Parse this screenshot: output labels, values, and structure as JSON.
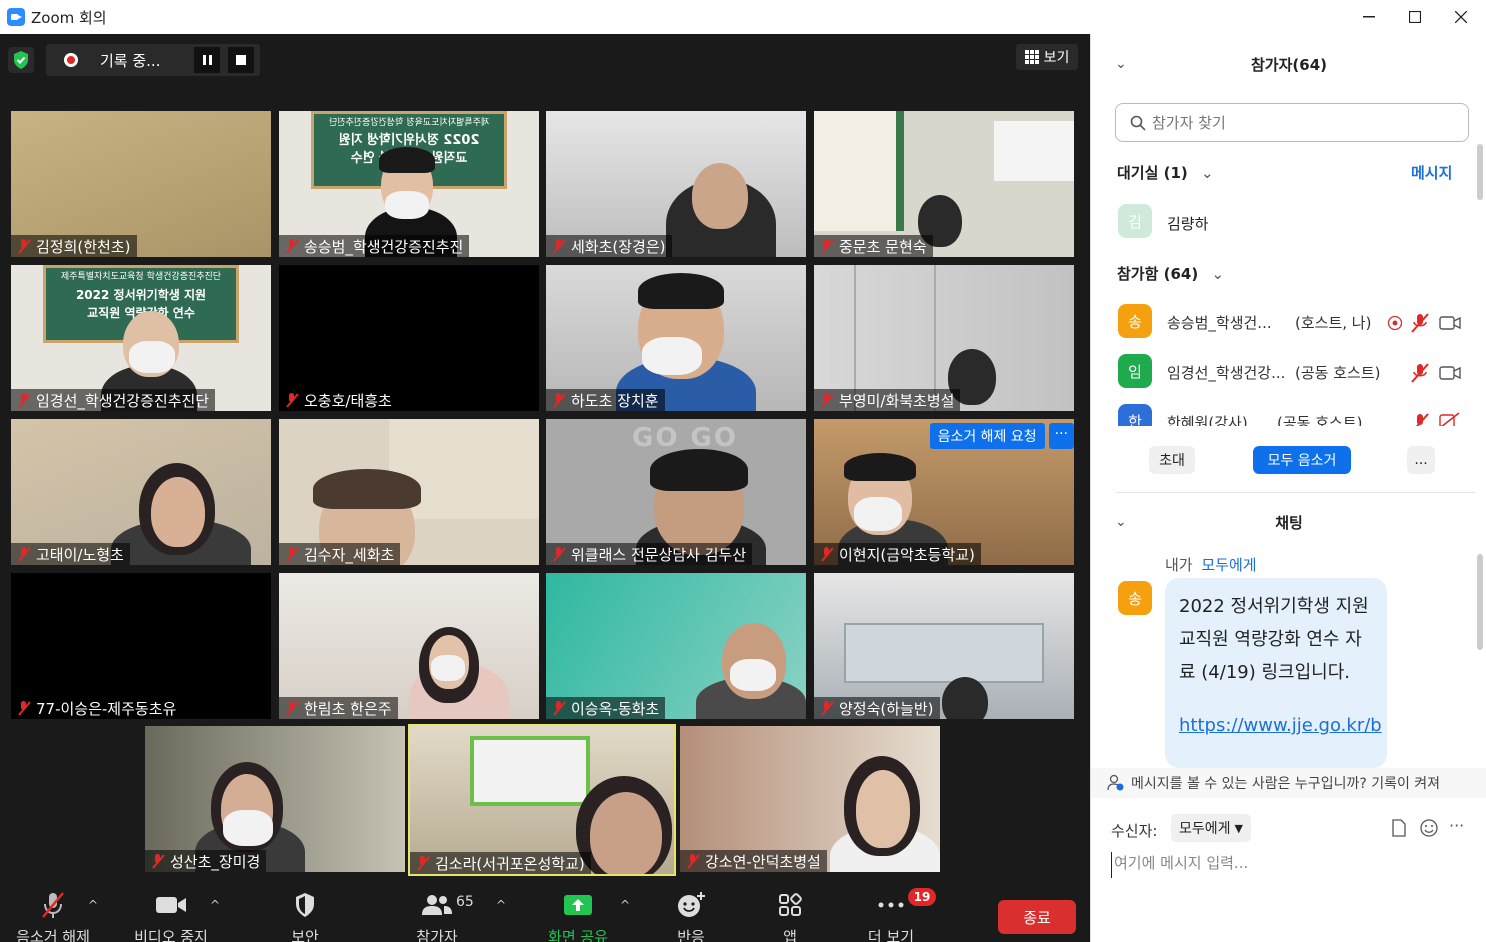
{
  "window": {
    "title": "Zoom 회의"
  },
  "recording": {
    "label": "기록 중..."
  },
  "view_button": {
    "label": "보기"
  },
  "tiles": [
    {
      "name": "김정희(한천초)"
    },
    {
      "name": "송승범_학생건강증진추진"
    },
    {
      "name": "세화초(장경은)"
    },
    {
      "name": "중문초 문현숙"
    },
    {
      "name": "임경선_학생건강증진추진단"
    },
    {
      "name": "오충호/태흥초"
    },
    {
      "name": "하도초 장치훈"
    },
    {
      "name": "부영미/화북초병설"
    },
    {
      "name": "고태이/노형초"
    },
    {
      "name": "김수자_세화초"
    },
    {
      "name": "위클래스 전문상담사 김두산"
    },
    {
      "name": "이현지(금악초등학교)"
    },
    {
      "name": "77-이승은-제주동초유"
    },
    {
      "name": "한림초 한은주"
    },
    {
      "name": "이승옥-동화초"
    },
    {
      "name": "양정숙(하늘반)"
    },
    {
      "name": "성산초_장미경"
    },
    {
      "name": "김소라(서귀포온성학교)"
    },
    {
      "name": "강소연-안덕초병설"
    }
  ],
  "banner": {
    "line1": "제주특별자치도교육청 학생건강증진추진단",
    "line2": "2022 정서위기학생 지원",
    "line3": "교직원 역량강화 연수",
    "mirrored_line2": "2022 정서위기학생 지원",
    "mirrored_line3": "교직원 역량강화 연수"
  },
  "wall_text": "GO GO",
  "unmute_request": {
    "label": "음소거 해제 요청",
    "more": "···"
  },
  "toolbar": {
    "unmute": "음소거 해제",
    "stop_video": "비디오 중지",
    "security": "보안",
    "participants": "참가자",
    "participants_count": "65",
    "share": "화면 공유",
    "reactions": "반응",
    "apps": "앱",
    "more": "더 보기",
    "more_badge": "19",
    "end": "종료"
  },
  "panel": {
    "participants_title": "참가자(64)",
    "search_placeholder": "참가자 찾기",
    "waiting_room": "대기실 (1)",
    "message_label": "메시지",
    "waiting": [
      {
        "initial": "김",
        "name": "김량하"
      }
    ],
    "joined": "참가함 (64)",
    "participants": [
      {
        "initial": "송",
        "name": "송승범_학생건...",
        "role": "(호스트, 나)",
        "color": "#f5a00f"
      },
      {
        "initial": "임",
        "name": "임경선_학생건강...",
        "role": "(공동 호스트)",
        "color": "#1fab4d"
      },
      {
        "initial": "한",
        "name": "한혜원(강사)",
        "role": "(공동 호스트)",
        "color": "#2d6fd8"
      }
    ],
    "invite": "초대",
    "mute_all": "모두 음소거",
    "more_dots": "...",
    "chat_title": "채팅",
    "chat_from": "내가",
    "chat_to": "모두에게",
    "chat_avatar": "송",
    "chat_message": "2022 정서위기학생 지원 교직원 역량강화 연수 자료 (4/19) 링크입니다.",
    "chat_link": "https://www.jje.go.kr/b",
    "visibility_note": "메시지를 볼 수 있는 사람은 누구입니까? 기록이 켜져",
    "recipient_label": "수신자:",
    "recipient_value": "모두에게",
    "input_placeholder": "여기에 메시지 입력..."
  },
  "colors": {
    "accent": "#2d8cff",
    "end_red": "#d9302f",
    "share_green": "#23c552"
  }
}
